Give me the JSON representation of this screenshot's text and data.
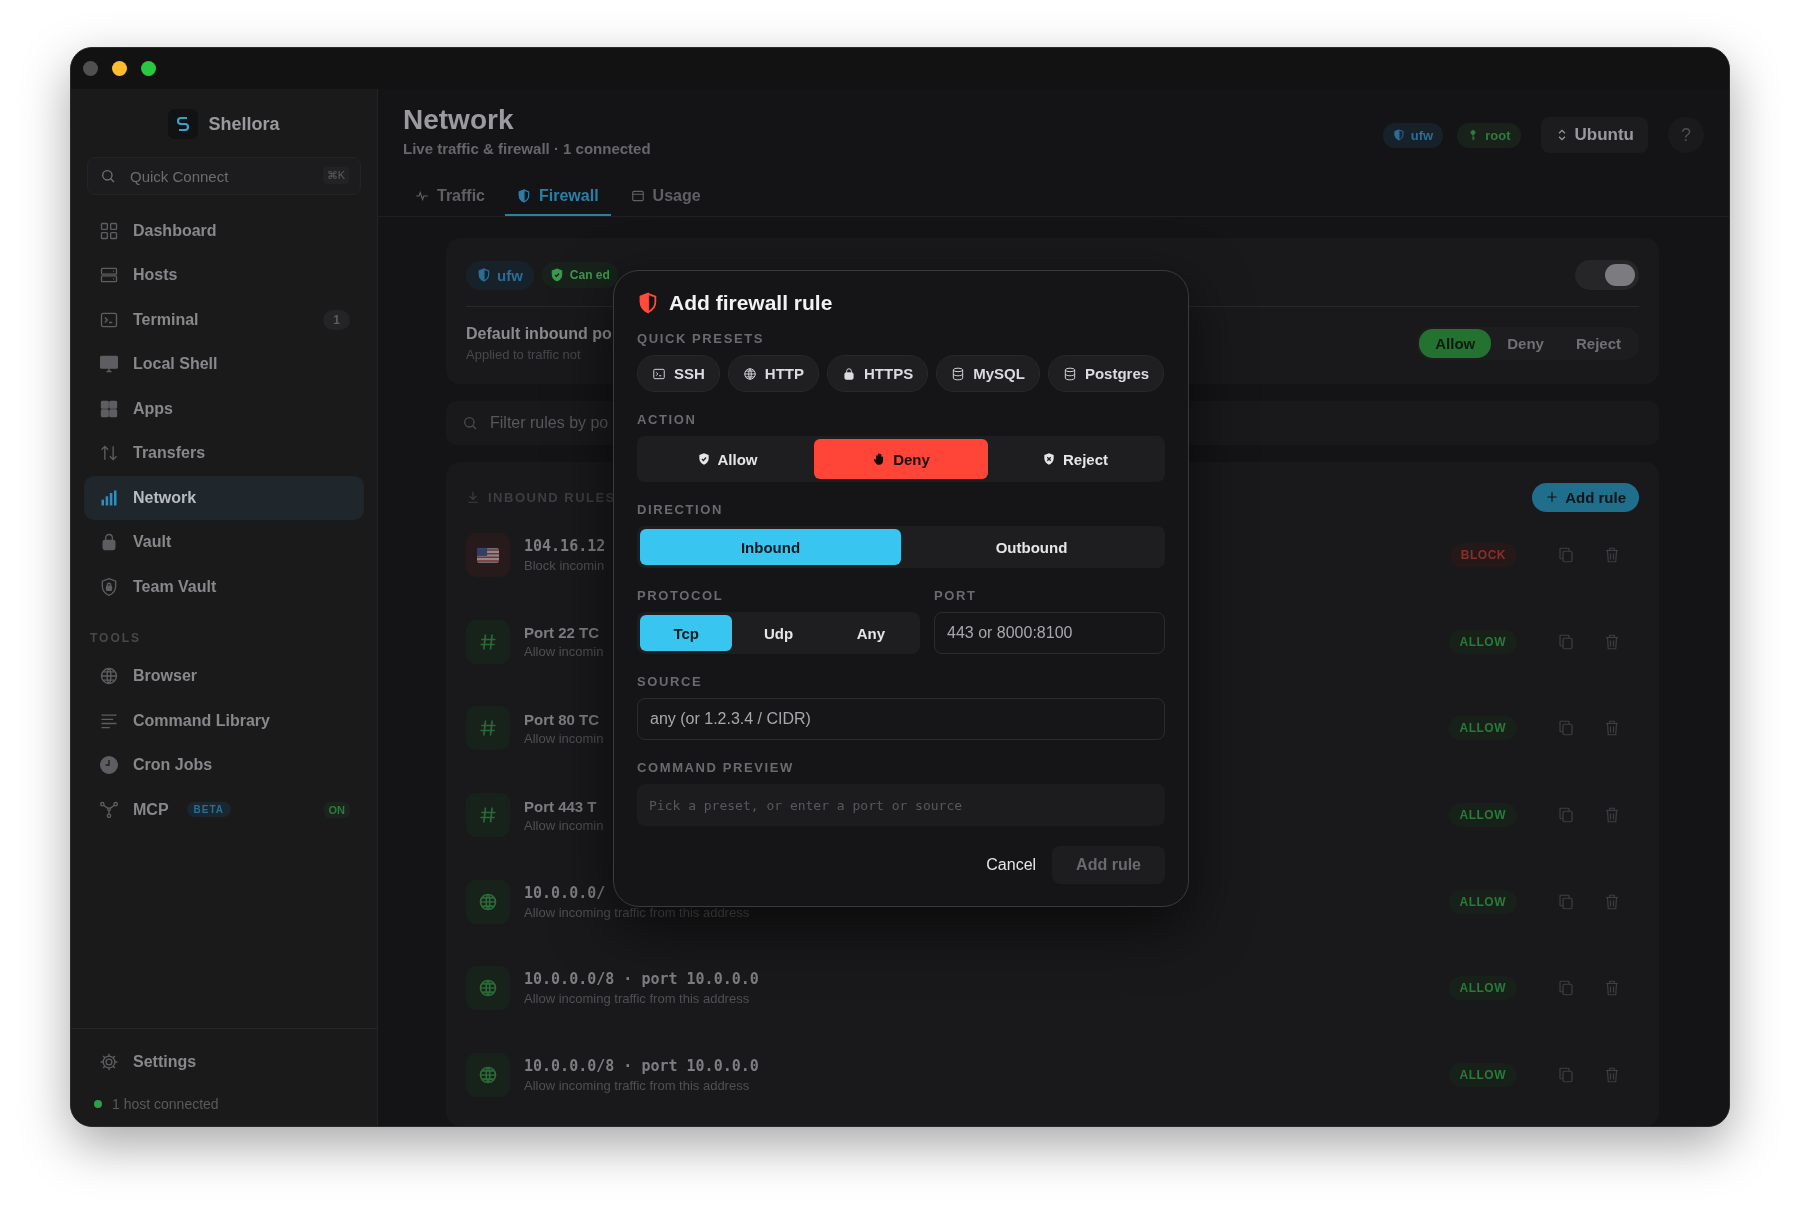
{
  "sidebar": {
    "app_name": "Shellora",
    "quick_connect": {
      "placeholder": "Quick Connect",
      "shortcut": "⌘K"
    },
    "items": [
      {
        "label": "Dashboard",
        "selected": false
      },
      {
        "label": "Hosts",
        "selected": false
      },
      {
        "label": "Terminal",
        "selected": false,
        "count": "1"
      },
      {
        "label": "Local Shell",
        "selected": false
      },
      {
        "label": "Apps",
        "selected": false
      },
      {
        "label": "Transfers",
        "selected": false
      },
      {
        "label": "Network",
        "selected": true
      },
      {
        "label": "Vault",
        "selected": false
      },
      {
        "label": "Team Vault",
        "selected": false
      }
    ],
    "tools_heading": "TOOLS",
    "tools": [
      {
        "label": "Browser",
        "selected": false
      },
      {
        "label": "Command Library",
        "selected": false
      },
      {
        "label": "Cron Jobs",
        "selected": false
      },
      {
        "label": "MCP",
        "selected": false,
        "tag": "BETA",
        "status": "ON"
      }
    ],
    "settings": "Settings",
    "status": {
      "text": "1 host connected",
      "online": true
    }
  },
  "header": {
    "title": "Network",
    "subtitle": "Live traffic & firewall · 1 connected",
    "badges": [
      {
        "label": "ufw",
        "kind": "info"
      },
      {
        "label": "root",
        "kind": "success"
      }
    ],
    "distro": "Ubuntu",
    "help": "?"
  },
  "tabs": [
    {
      "label": "Traffic",
      "selected": false
    },
    {
      "label": "Firewall",
      "selected": true
    },
    {
      "label": "Usage",
      "selected": false
    }
  ],
  "firewall": {
    "badges": [
      {
        "label": "ufw",
        "kind": "info"
      },
      {
        "label": "Can ed",
        "kind": "success"
      }
    ],
    "enabled": true,
    "policy": {
      "title": "Default inbound po",
      "subtitle": "Applied to traffic not",
      "options": [
        {
          "label": "Allow",
          "selected": true
        },
        {
          "label": "Deny",
          "selected": false
        },
        {
          "label": "Reject",
          "selected": false
        }
      ]
    }
  },
  "filter": {
    "placeholder": "Filter rules by po"
  },
  "rules": {
    "heading": "INBOUND RULES",
    "add_button": "Add rule",
    "items": [
      {
        "kind": "flag",
        "title": "104.16.12",
        "subtitle": "Block incomin",
        "verdict": {
          "label": "BLOCK",
          "kind": "block"
        }
      },
      {
        "kind": "port",
        "title": "Port 22 TC",
        "subtitle": "Allow incomin",
        "verdict": {
          "label": "ALLOW",
          "kind": "allow"
        }
      },
      {
        "kind": "port",
        "title": "Port 80 TC",
        "subtitle": "Allow incomin",
        "verdict": {
          "label": "ALLOW",
          "kind": "allow"
        }
      },
      {
        "kind": "port",
        "title": "Port 443 T",
        "subtitle": "Allow incomin",
        "verdict": {
          "label": "ALLOW",
          "kind": "allow"
        }
      },
      {
        "kind": "address",
        "title": "10.0.0.0/",
        "subtitle": "Allow incoming traffic from this address",
        "verdict": {
          "label": "ALLOW",
          "kind": "allow"
        }
      },
      {
        "kind": "address",
        "title": "10.0.0.0/8 · port 10.0.0.0",
        "subtitle": "Allow incoming traffic from this address",
        "verdict": {
          "label": "ALLOW",
          "kind": "allow"
        }
      },
      {
        "kind": "address",
        "title": "10.0.0.0/8 · port 10.0.0.0",
        "subtitle": "Allow incoming traffic from this address",
        "verdict": {
          "label": "ALLOW",
          "kind": "allow"
        }
      }
    ]
  },
  "dialog": {
    "title": "Add firewall rule",
    "presets_label": "QUICK PRESETS",
    "presets": [
      {
        "label": "SSH",
        "kind": "terminal"
      },
      {
        "label": "HTTP",
        "kind": "web"
      },
      {
        "label": "HTTPS",
        "kind": "secure"
      },
      {
        "label": "MySQL",
        "kind": "database"
      },
      {
        "label": "Postgres",
        "kind": "database"
      }
    ],
    "action_label": "ACTION",
    "actions": [
      {
        "label": "Allow",
        "selected": false
      },
      {
        "label": "Deny",
        "selected": true
      },
      {
        "label": "Reject",
        "selected": false
      }
    ],
    "direction_label": "DIRECTION",
    "directions": [
      {
        "label": "Inbound",
        "selected": true
      },
      {
        "label": "Outbound",
        "selected": false
      }
    ],
    "protocol_label": "PROTOCOL",
    "protocols": [
      {
        "label": "Tcp",
        "selected": true
      },
      {
        "label": "Udp",
        "selected": false
      },
      {
        "label": "Any",
        "selected": false
      }
    ],
    "port_label": "PORT",
    "port": {
      "placeholder": "443 or 8000:8100"
    },
    "source_label": "SOURCE",
    "source": {
      "placeholder": "any (or 1.2.3.4 / CIDR)"
    },
    "preview_label": "COMMAND PREVIEW",
    "preview_hint": "Pick a preset, or enter a port or source",
    "cancel": "Cancel",
    "submit": {
      "label": "Add rule",
      "disabled": true
    }
  }
}
